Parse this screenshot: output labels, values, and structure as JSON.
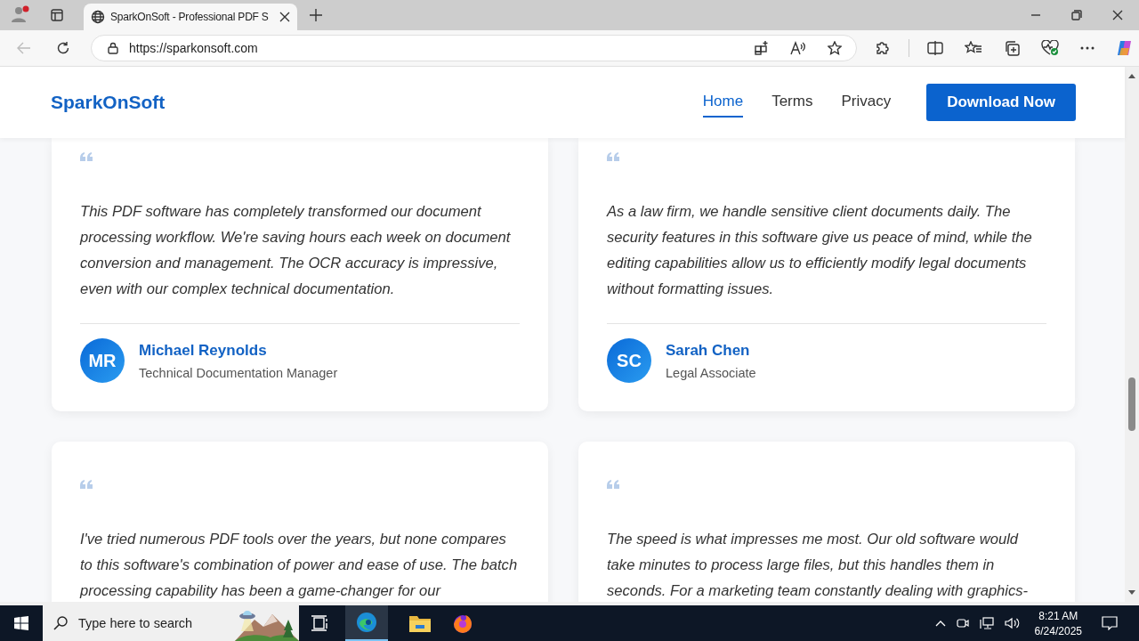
{
  "browser": {
    "tab": {
      "title": "SparkOnSoft - Professional PDF S",
      "selected": true
    },
    "url": "https://sparkonsoft.com"
  },
  "site": {
    "logo": "SparkOnSoft",
    "nav": [
      {
        "label": "Home",
        "selected": true
      },
      {
        "label": "Terms",
        "selected": false
      },
      {
        "label": "Privacy",
        "selected": false
      }
    ],
    "cta": "Download Now"
  },
  "testimonials": [
    {
      "quote": "This PDF software has completely transformed our document processing workflow. We're saving hours each week on document conversion and management. The OCR accuracy is impressive, even with our complex technical documentation.",
      "initials": "MR",
      "name": "Michael Reynolds",
      "role": "Technical Documentation Manager"
    },
    {
      "quote": "As a law firm, we handle sensitive client documents daily. The security features in this software give us peace of mind, while the editing capabilities allow us to efficiently modify legal documents without formatting issues.",
      "initials": "SC",
      "name": "Sarah Chen",
      "role": "Legal Associate"
    },
    {
      "quote": "I've tried numerous PDF tools over the years, but none compares to this software's combination of power and ease of use. The batch processing capability has been a game-changer for our"
    },
    {
      "quote": "The speed is what impresses me most. Our old software would take minutes to process large files, but this handles them in seconds. For a marketing team constantly dealing with graphics-"
    }
  ],
  "taskbar": {
    "search_placeholder": "Type here to search",
    "time": "8:21 AM",
    "date": "6/24/2025"
  }
}
